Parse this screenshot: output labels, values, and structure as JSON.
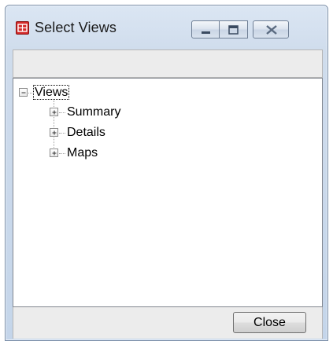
{
  "window": {
    "title": "Select Views",
    "icon": "app-views-icon"
  },
  "caption_buttons": {
    "minimize_icon": "minimize-icon",
    "maximize_icon": "maximize-icon",
    "close_icon": "close-icon"
  },
  "tree": {
    "root": {
      "label": "Views",
      "expanded": true,
      "focused": true
    },
    "children": [
      {
        "label": "Summary",
        "expanded": false
      },
      {
        "label": "Details",
        "expanded": false
      },
      {
        "label": "Maps",
        "expanded": false
      }
    ]
  },
  "footer": {
    "close_label": "Close"
  },
  "colors": {
    "app_icon": "#d42a2a",
    "window_frame": "#c4d5ea",
    "panel": "#ececec"
  }
}
